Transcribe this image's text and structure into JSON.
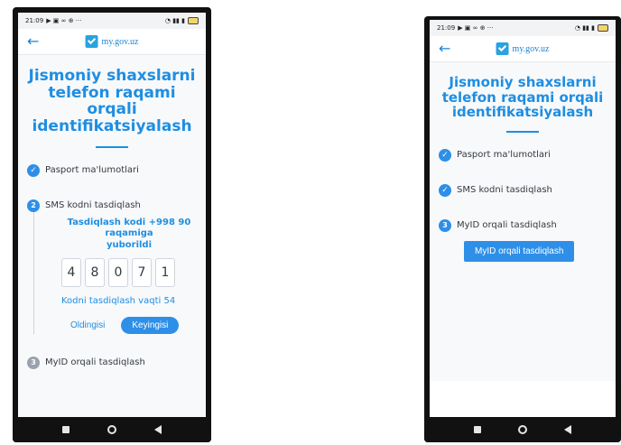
{
  "left_phone": {
    "status": {
      "time": "21:09",
      "left_icons": "▶ ▣ ∞ ⊕ ···",
      "right_icons": "◔ ▮▮ ▮"
    },
    "header": {
      "back_label": "←",
      "logo_text": "my.gov.uz"
    },
    "title": "Jismoniy shaxslarni telefon raqami orqali identifikatsiyalash",
    "steps": [
      {
        "label": "Pasport ma'lumotlari",
        "state": "done"
      },
      {
        "label": "SMS kodni tasdiqlash",
        "state": "active",
        "number": "2"
      },
      {
        "label": "MyID orqali tasdiqlash",
        "state": "inactive",
        "number": "3"
      }
    ],
    "sms_note": "Tasdiqlash kodi +998 90\nraqamiga\nyuborildi",
    "code_digits": [
      "4",
      "8",
      "0",
      "7",
      "1"
    ],
    "timer_text": "Kodni tasdiqlash vaqti 54",
    "buttons": {
      "prev": "Oldingisi",
      "next": "Keyingisi"
    }
  },
  "right_phone": {
    "status": {
      "time": "21:09",
      "left_icons": "▶ ▣ ∞ ⊕ ···",
      "right_icons": "◔ ▮▮ ▮"
    },
    "header": {
      "back_label": "←",
      "logo_text": "my.gov.uz"
    },
    "title": "Jismoniy shaxslarni telefon raqami orqali identifikatsiyalash",
    "steps": [
      {
        "label": "Pasport ma'lumotlari",
        "state": "done"
      },
      {
        "label": "SMS kodni tasdiqlash",
        "state": "done"
      },
      {
        "label": "MyID orqali tasdiqlash",
        "state": "active",
        "number": "3"
      }
    ],
    "myid_button": "MyID orqali tasdiqlash"
  }
}
